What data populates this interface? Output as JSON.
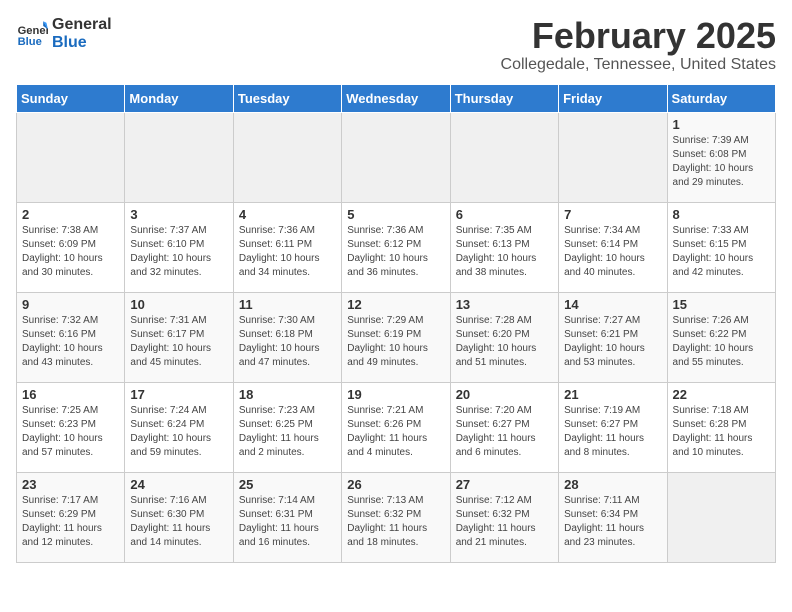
{
  "header": {
    "logo_general": "General",
    "logo_blue": "Blue",
    "month": "February 2025",
    "location": "Collegedale, Tennessee, United States"
  },
  "days_of_week": [
    "Sunday",
    "Monday",
    "Tuesday",
    "Wednesday",
    "Thursday",
    "Friday",
    "Saturday"
  ],
  "weeks": [
    [
      {
        "day": "",
        "info": ""
      },
      {
        "day": "",
        "info": ""
      },
      {
        "day": "",
        "info": ""
      },
      {
        "day": "",
        "info": ""
      },
      {
        "day": "",
        "info": ""
      },
      {
        "day": "",
        "info": ""
      },
      {
        "day": "1",
        "info": "Sunrise: 7:39 AM\nSunset: 6:08 PM\nDaylight: 10 hours and 29 minutes."
      }
    ],
    [
      {
        "day": "2",
        "info": "Sunrise: 7:38 AM\nSunset: 6:09 PM\nDaylight: 10 hours and 30 minutes."
      },
      {
        "day": "3",
        "info": "Sunrise: 7:37 AM\nSunset: 6:10 PM\nDaylight: 10 hours and 32 minutes."
      },
      {
        "day": "4",
        "info": "Sunrise: 7:36 AM\nSunset: 6:11 PM\nDaylight: 10 hours and 34 minutes."
      },
      {
        "day": "5",
        "info": "Sunrise: 7:36 AM\nSunset: 6:12 PM\nDaylight: 10 hours and 36 minutes."
      },
      {
        "day": "6",
        "info": "Sunrise: 7:35 AM\nSunset: 6:13 PM\nDaylight: 10 hours and 38 minutes."
      },
      {
        "day": "7",
        "info": "Sunrise: 7:34 AM\nSunset: 6:14 PM\nDaylight: 10 hours and 40 minutes."
      },
      {
        "day": "8",
        "info": "Sunrise: 7:33 AM\nSunset: 6:15 PM\nDaylight: 10 hours and 42 minutes."
      }
    ],
    [
      {
        "day": "9",
        "info": "Sunrise: 7:32 AM\nSunset: 6:16 PM\nDaylight: 10 hours and 43 minutes."
      },
      {
        "day": "10",
        "info": "Sunrise: 7:31 AM\nSunset: 6:17 PM\nDaylight: 10 hours and 45 minutes."
      },
      {
        "day": "11",
        "info": "Sunrise: 7:30 AM\nSunset: 6:18 PM\nDaylight: 10 hours and 47 minutes."
      },
      {
        "day": "12",
        "info": "Sunrise: 7:29 AM\nSunset: 6:19 PM\nDaylight: 10 hours and 49 minutes."
      },
      {
        "day": "13",
        "info": "Sunrise: 7:28 AM\nSunset: 6:20 PM\nDaylight: 10 hours and 51 minutes."
      },
      {
        "day": "14",
        "info": "Sunrise: 7:27 AM\nSunset: 6:21 PM\nDaylight: 10 hours and 53 minutes."
      },
      {
        "day": "15",
        "info": "Sunrise: 7:26 AM\nSunset: 6:22 PM\nDaylight: 10 hours and 55 minutes."
      }
    ],
    [
      {
        "day": "16",
        "info": "Sunrise: 7:25 AM\nSunset: 6:23 PM\nDaylight: 10 hours and 57 minutes."
      },
      {
        "day": "17",
        "info": "Sunrise: 7:24 AM\nSunset: 6:24 PM\nDaylight: 10 hours and 59 minutes."
      },
      {
        "day": "18",
        "info": "Sunrise: 7:23 AM\nSunset: 6:25 PM\nDaylight: 11 hours and 2 minutes."
      },
      {
        "day": "19",
        "info": "Sunrise: 7:21 AM\nSunset: 6:26 PM\nDaylight: 11 hours and 4 minutes."
      },
      {
        "day": "20",
        "info": "Sunrise: 7:20 AM\nSunset: 6:27 PM\nDaylight: 11 hours and 6 minutes."
      },
      {
        "day": "21",
        "info": "Sunrise: 7:19 AM\nSunset: 6:27 PM\nDaylight: 11 hours and 8 minutes."
      },
      {
        "day": "22",
        "info": "Sunrise: 7:18 AM\nSunset: 6:28 PM\nDaylight: 11 hours and 10 minutes."
      }
    ],
    [
      {
        "day": "23",
        "info": "Sunrise: 7:17 AM\nSunset: 6:29 PM\nDaylight: 11 hours and 12 minutes."
      },
      {
        "day": "24",
        "info": "Sunrise: 7:16 AM\nSunset: 6:30 PM\nDaylight: 11 hours and 14 minutes."
      },
      {
        "day": "25",
        "info": "Sunrise: 7:14 AM\nSunset: 6:31 PM\nDaylight: 11 hours and 16 minutes."
      },
      {
        "day": "26",
        "info": "Sunrise: 7:13 AM\nSunset: 6:32 PM\nDaylight: 11 hours and 18 minutes."
      },
      {
        "day": "27",
        "info": "Sunrise: 7:12 AM\nSunset: 6:32 PM\nDaylight: 11 hours and 21 minutes."
      },
      {
        "day": "28",
        "info": "Sunrise: 7:11 AM\nSunset: 6:34 PM\nDaylight: 11 hours and 23 minutes."
      },
      {
        "day": "",
        "info": ""
      }
    ]
  ]
}
